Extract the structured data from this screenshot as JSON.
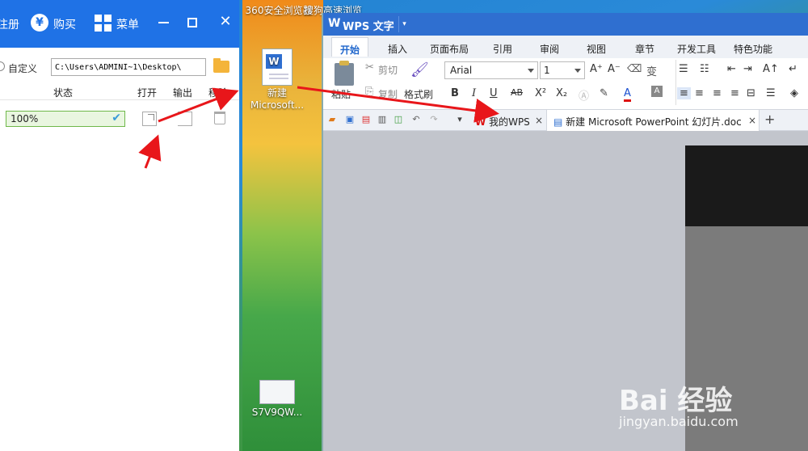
{
  "colors": {
    "accent": "#1f72e6",
    "wps_blue": "#2f6fd0",
    "progress_green": "#6fb84a",
    "arrow_red": "#e8161a"
  },
  "desktop": {
    "top_icon_1_label": "360安全浏览器",
    "top_icon_2_label": "搜狗高速浏览",
    "new_file_icon_label_line1": "新建",
    "new_file_icon_label_line2": "Microsoft...",
    "thumb_icon_label": "S7V9QW..."
  },
  "converter": {
    "title_partial": "注册",
    "buy_label": "购买",
    "buy_icon": "yen-icon",
    "menu_label": "菜单",
    "menu_icon": "grid-icon",
    "minimize_label": "—",
    "maximize_label": "□",
    "close_label": "✕",
    "custom_label": "自定义",
    "path_value": "C:\\Users\\ADMINI~1\\Desktop\\",
    "columns": {
      "status": "状态",
      "open": "打开",
      "output": "输出",
      "remove": "移除"
    },
    "row": {
      "progress_text": "100%",
      "progress": 1.0,
      "check": "✔"
    }
  },
  "wps": {
    "title": "WPS 文字",
    "title_dropdown": "▾",
    "menu_tabs": [
      "开始",
      "插入",
      "页面布局",
      "引用",
      "审阅",
      "视图",
      "章节",
      "开发工具",
      "特色功能"
    ],
    "ribbon": {
      "paste_label": "粘贴",
      "cut_label": "剪切",
      "copy_label": "复制",
      "format_painter_label": "格式刷",
      "font_name": "Arial",
      "font_size": "1",
      "bold": "B",
      "italic": "I",
      "underline": "U",
      "strikethrough": "AB",
      "superscript": "X²",
      "subscript": "X₂",
      "font_color": "A",
      "font_grow": "A⁺",
      "font_shrink": "A⁻",
      "phonetic": "变"
    },
    "doc_tabs": [
      {
        "label": "我的WPS",
        "close": "×"
      },
      {
        "label": "新建 Microsoft PowerPoint 幻灯片.doc",
        "close": "×"
      }
    ],
    "new_tab": "+"
  },
  "watermark": {
    "brand": "Bai 经验",
    "url": "jingyan.baidu.com"
  }
}
